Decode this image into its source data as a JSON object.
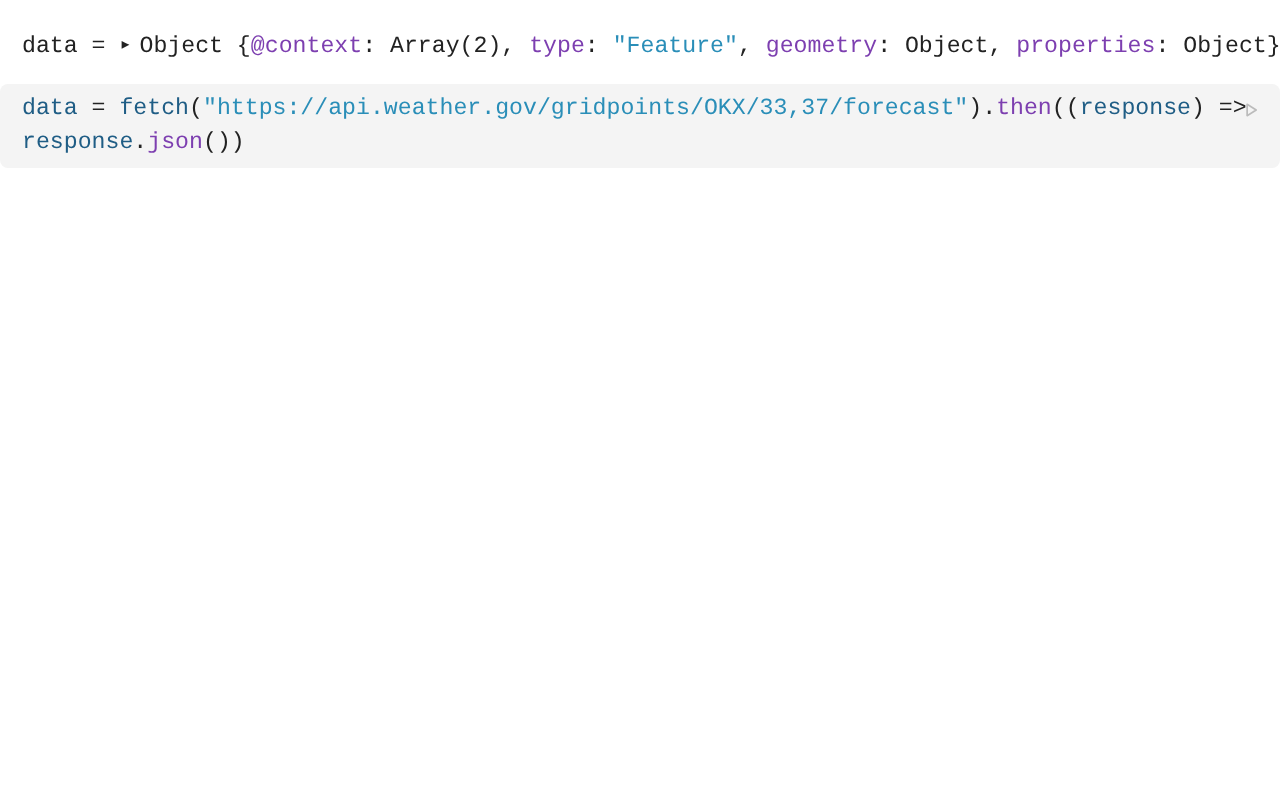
{
  "output": {
    "expanded": false,
    "tokens": [
      {
        "kind": "plain",
        "text": "data = "
      },
      {
        "kind": "toggle",
        "text": "▸"
      },
      {
        "kind": "plain",
        "text": "Object {"
      },
      {
        "kind": "key",
        "text": "@context"
      },
      {
        "kind": "plain",
        "text": ": Array(2), "
      },
      {
        "kind": "key",
        "text": "type"
      },
      {
        "kind": "plain",
        "text": ": "
      },
      {
        "kind": "string",
        "text": "\"Feature\""
      },
      {
        "kind": "plain",
        "text": ", "
      },
      {
        "kind": "key",
        "text": "geometry"
      },
      {
        "kind": "plain",
        "text": ": Object, "
      },
      {
        "kind": "key",
        "text": "properties"
      },
      {
        "kind": "plain",
        "text": ": Object}"
      }
    ]
  },
  "cell": {
    "lines": [
      [
        {
          "kind": "variable",
          "text": "data"
        },
        {
          "kind": "plain",
          "text": " = "
        },
        {
          "kind": "variable",
          "text": "fetch"
        },
        {
          "kind": "plain",
          "text": "("
        },
        {
          "kind": "string",
          "text": "\"https://api.weather.gov/gridpoints/OKX/33,37/forecast\""
        },
        {
          "kind": "plain",
          "text": ")."
        },
        {
          "kind": "key",
          "text": "then"
        },
        {
          "kind": "plain",
          "text": "(("
        },
        {
          "kind": "variable",
          "text": "response"
        },
        {
          "kind": "plain",
          "text": ") =>"
        }
      ],
      [
        {
          "kind": "variable",
          "text": "response"
        },
        {
          "kind": "plain",
          "text": "."
        },
        {
          "kind": "key",
          "text": "json"
        },
        {
          "kind": "plain",
          "text": "())"
        }
      ]
    ]
  }
}
